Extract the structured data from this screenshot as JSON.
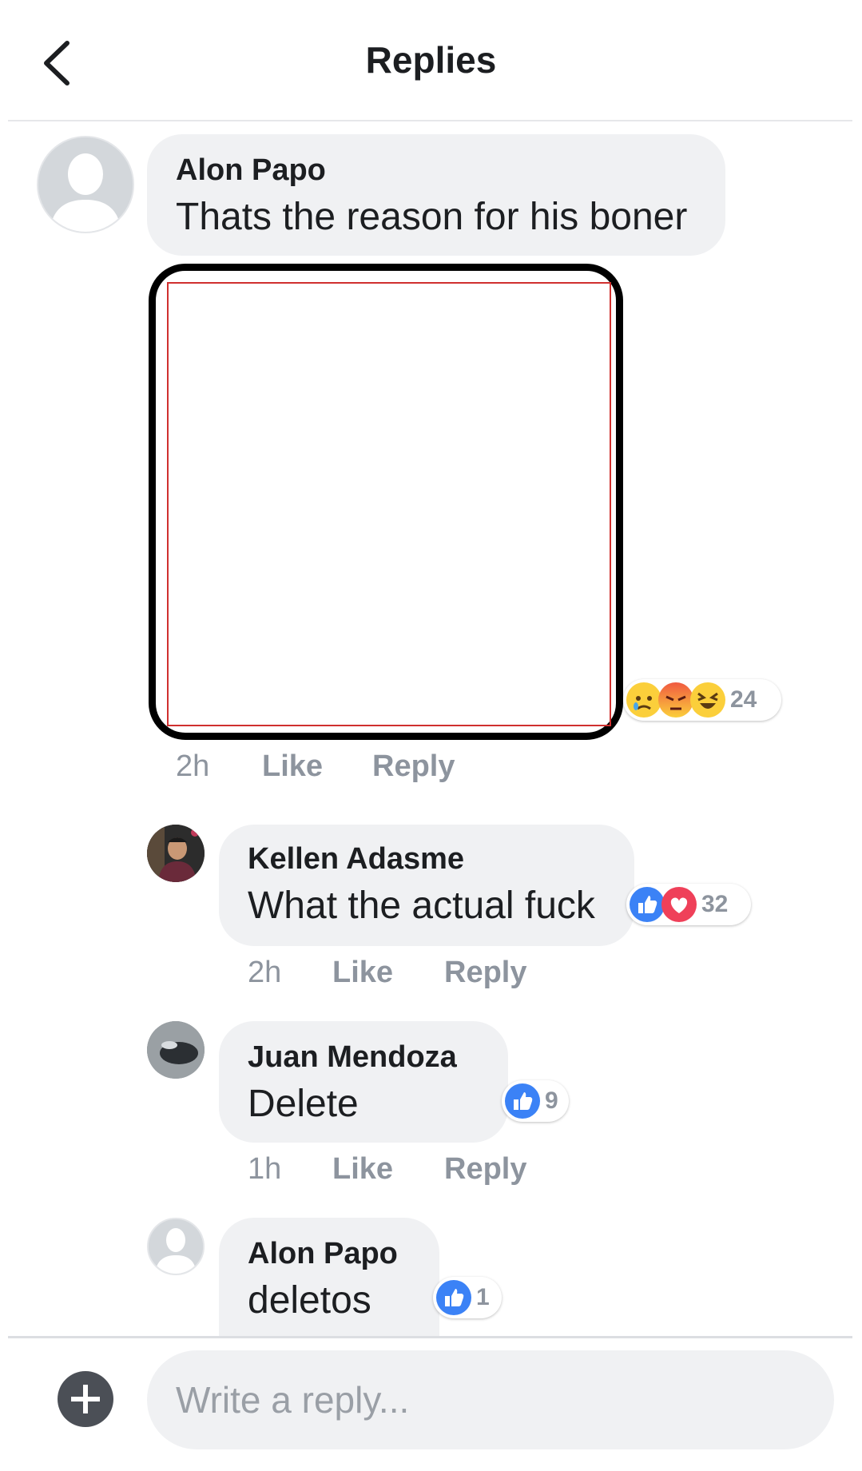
{
  "header": {
    "title": "Replies"
  },
  "comments": [
    {
      "name": "Alon Papo",
      "text": "Thats the reason for his boner",
      "time": "2h",
      "like_label": "Like",
      "reply_label": "Reply",
      "reaction_count": "24",
      "reaction_icons": [
        "sad-icon",
        "angry-icon",
        "haha-icon"
      ]
    },
    {
      "name": "Kellen Adasme",
      "text": "What the actual fuck",
      "time": "2h",
      "like_label": "Like",
      "reply_label": "Reply",
      "reaction_count": "32",
      "reaction_icons": [
        "like-icon",
        "love-icon"
      ]
    },
    {
      "name": "Juan Mendoza",
      "text": "Delete",
      "time": "1h",
      "like_label": "Like",
      "reply_label": "Reply",
      "reaction_count": "9",
      "reaction_icons": [
        "like-icon"
      ]
    },
    {
      "name": "Alon Papo",
      "text": "deletos",
      "reaction_count": "1",
      "reaction_icons": [
        "like-icon"
      ]
    }
  ],
  "composer": {
    "placeholder": "Write a reply..."
  },
  "colors": {
    "like_blue": "#3b82f6",
    "love_red": "#ef4059",
    "bubble_gray": "#f0f1f3",
    "muted_text": "#8d949e"
  }
}
